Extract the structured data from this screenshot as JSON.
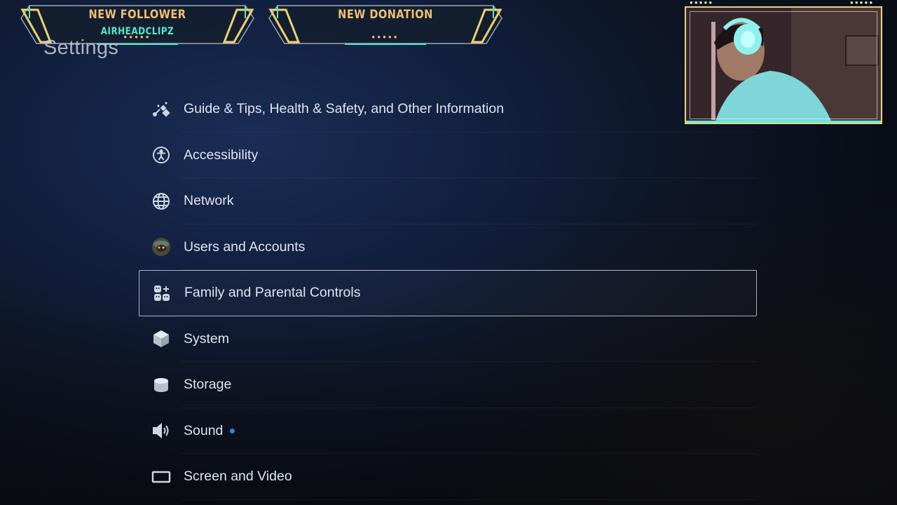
{
  "page": {
    "title": "Settings"
  },
  "alerts": {
    "follower": {
      "title": "NEW FOLLOWER",
      "name": "AIRHEADCLIPZ"
    },
    "donation": {
      "title": "NEW DONATION"
    }
  },
  "menu": {
    "selected_index": 4,
    "items": [
      {
        "label": "Guide & Tips, Health & Safety, and Other Information",
        "icon": "guide-icon"
      },
      {
        "label": "Accessibility",
        "icon": "accessibility-icon"
      },
      {
        "label": "Network",
        "icon": "globe-icon"
      },
      {
        "label": "Users and Accounts",
        "icon": "user-avatar-icon"
      },
      {
        "label": "Family and Parental Controls",
        "icon": "family-controls-icon"
      },
      {
        "label": "System",
        "icon": "cube-icon"
      },
      {
        "label": "Storage",
        "icon": "storage-icon"
      },
      {
        "label": "Sound",
        "icon": "speaker-icon",
        "badge": true
      },
      {
        "label": "Screen and Video",
        "icon": "screen-icon"
      }
    ]
  },
  "colors": {
    "accent_gold": "#f0c070",
    "accent_teal": "#56e6c9",
    "badge_blue": "#2e86e8"
  }
}
